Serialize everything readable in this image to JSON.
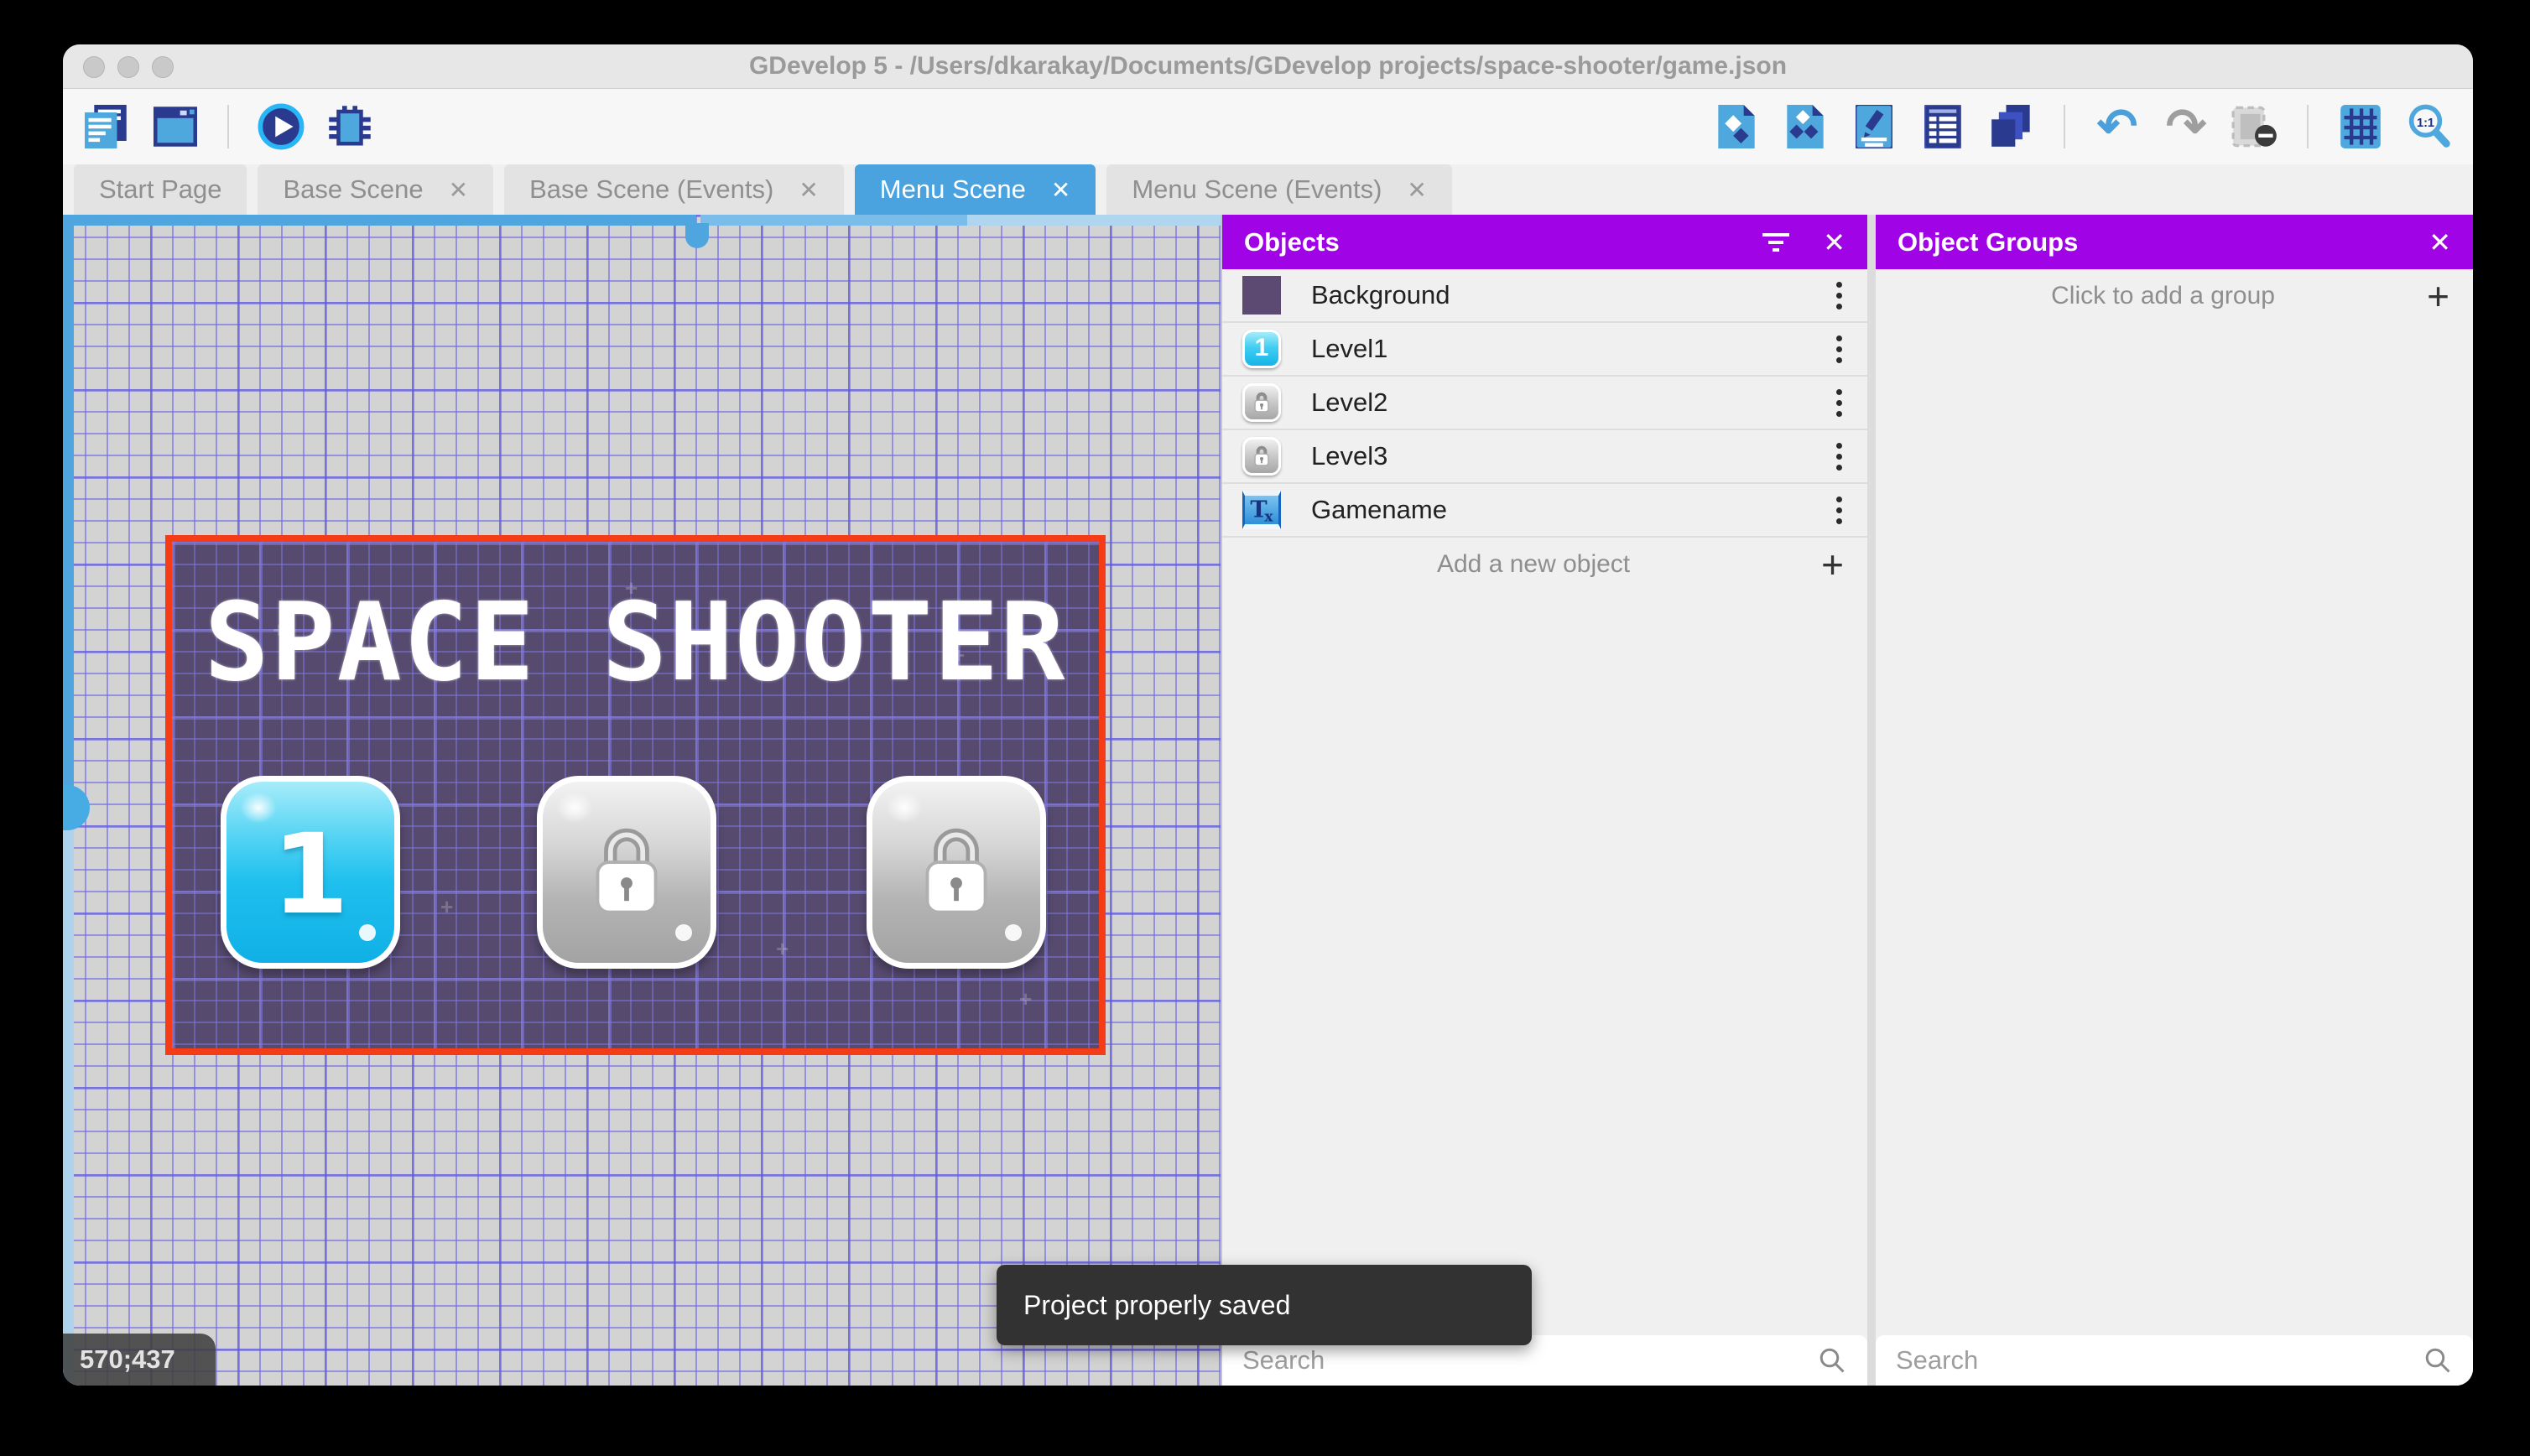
{
  "window": {
    "title": "GDevelop 5 - /Users/dkarakay/Documents/GDevelop projects/space-shooter/game.json"
  },
  "toolbar": {
    "left_icons": [
      "project-manager",
      "scene-window",
      "play-preview",
      "debug"
    ],
    "right_icons": [
      "objects-panel",
      "object-groups-panel",
      "properties",
      "instances-list",
      "layers",
      "undo",
      "redo",
      "toggle-mask",
      "grid",
      "zoom-original"
    ],
    "undo_glyph": "↶",
    "redo_glyph": "↷",
    "zoom_label": "1:1"
  },
  "tabs": [
    {
      "label": "Start Page",
      "closable": false,
      "active": false
    },
    {
      "label": "Base Scene",
      "closable": true,
      "active": false
    },
    {
      "label": "Base Scene (Events)",
      "closable": true,
      "active": false
    },
    {
      "label": "Menu Scene",
      "closable": true,
      "active": true
    },
    {
      "label": "Menu Scene (Events)",
      "closable": true,
      "active": false
    }
  ],
  "shared": {
    "close_glyph": "✕",
    "plus_glyph": "+"
  },
  "canvas": {
    "coords": "570;437",
    "scene": {
      "title": "SPACE SHOOTER",
      "level1_label": "1",
      "buttons": [
        "level1-unlocked",
        "level2-locked",
        "level3-locked"
      ]
    }
  },
  "objects_panel": {
    "title": "Objects",
    "items": [
      {
        "name": "Background",
        "thumb": "purple-square"
      },
      {
        "name": "Level1",
        "thumb": "blue-button-1"
      },
      {
        "name": "Level2",
        "thumb": "gray-lock-button"
      },
      {
        "name": "Level3",
        "thumb": "gray-lock-button"
      },
      {
        "name": "Gamename",
        "thumb": "text-object"
      }
    ],
    "add_label": "Add a new object",
    "search_placeholder": "Search"
  },
  "groups_panel": {
    "title": "Object Groups",
    "empty_label": "Click to add a group",
    "search_placeholder": "Search"
  },
  "toast": {
    "message": "Project properly saved"
  },
  "colors": {
    "panel_header_purple": "#a004e6",
    "active_tab_blue": "#4aa3df",
    "selection_red": "#f43d16",
    "scene_purple": "#564a6e",
    "scrollbar_blue": "#4fa6df"
  }
}
